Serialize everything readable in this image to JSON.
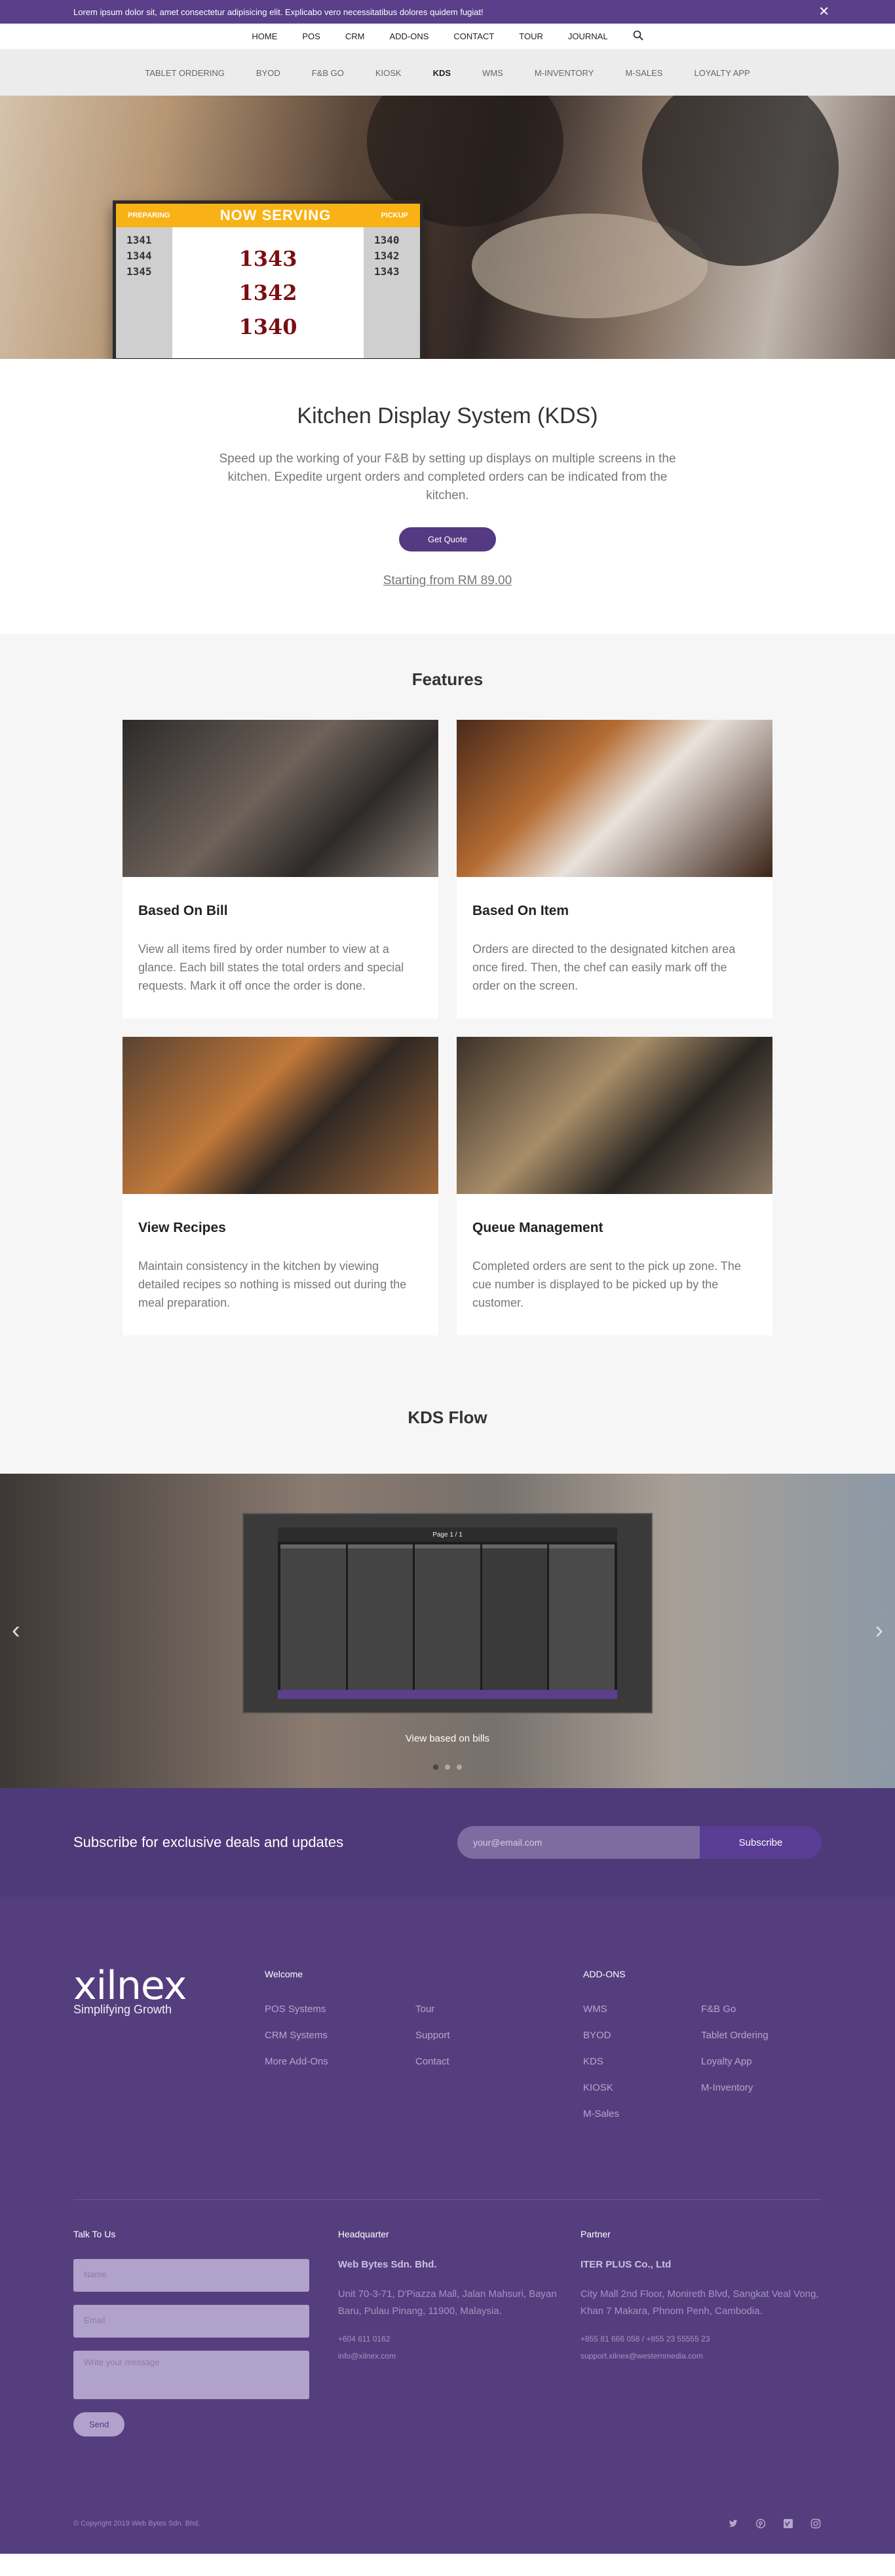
{
  "announcement": {
    "text": "Lorem ipsum dolor sit, amet consectetur adipisicing elit. Explicabo vero necessitatibus dolores quidem fugiat!",
    "close_icon": "✕"
  },
  "topnav": [
    "HOME",
    "POS",
    "CRM",
    "ADD-ONS",
    "CONTACT",
    "TOUR",
    "JOURNAL"
  ],
  "subnav": {
    "items": [
      "TABLET ORDERING",
      "BYOD",
      "F&B GO",
      "KIOSK",
      "KDS",
      "WMS",
      "M-INVENTORY",
      "M-SALES",
      "LOYALTY APP"
    ],
    "active": "KDS"
  },
  "hero_sign": {
    "title": "NOW SERVING",
    "left_label": "PREPARING",
    "right_label": "PICKUP",
    "preparing": [
      "1341",
      "1344",
      "1345"
    ],
    "serving": [
      "1343",
      "1342",
      "1340"
    ],
    "pickup": [
      "1340",
      "1342",
      "1343"
    ]
  },
  "intro": {
    "title": "Kitchen Display System (KDS)",
    "description": "Speed up the working of your F&B by setting up displays on multiple screens in the kitchen. Expedite urgent orders and completed orders can be indicated from the kitchen.",
    "cta": "Get Quote",
    "price": "Starting from RM 89.00"
  },
  "features": {
    "title": "Features",
    "cards": [
      {
        "title": "Based On Bill",
        "text": "View all items fired by order number to view at a glance. Each bill states the total orders and special requests. Mark it off once the order is done."
      },
      {
        "title": "Based On Item",
        "text": "Orders are directed to the designated kitchen area once fired. Then, the chef can easily mark off the order on the screen."
      },
      {
        "title": "View Recipes",
        "text": "Maintain consistency in the kitchen by viewing detailed recipes so nothing is missed out during the meal preparation."
      },
      {
        "title": "Queue Management",
        "text": "Completed orders are sent to the pick up zone. The cue number is displayed to be picked up by the customer."
      }
    ]
  },
  "flow": {
    "title": "KDS Flow",
    "caption": "View based on bills",
    "screen_page": "Page 1 / 1"
  },
  "subscribe": {
    "title": "Subscribe for exclusive deals and updates",
    "placeholder": "your@email.com",
    "button": "Subscribe"
  },
  "footer": {
    "logo": "xilnex",
    "tagline": "Simplifying Growth",
    "welcome": {
      "title": "Welcome",
      "col1": [
        "POS Systems",
        "CRM Systems",
        "More Add-Ons"
      ],
      "col2": [
        "Tour",
        "Support",
        "Contact"
      ]
    },
    "addons": {
      "title": "ADD-ONS",
      "col1": [
        "WMS",
        "BYOD",
        "KDS",
        "KIOSK",
        "M-Sales"
      ],
      "col2": [
        "F&B Go",
        "Tablet Ordering",
        "Loyalty App",
        "M-Inventory"
      ]
    },
    "talk": {
      "title": "Talk To Us",
      "name": "Name",
      "email": "Email",
      "message": "Write your message",
      "send": "Send"
    },
    "hq": {
      "title": "Headquarter",
      "company": "Web Bytes Sdn. Bhd.",
      "address": "Unit 70-3-71, D'Piazza Mall, Jalan Mahsuri, Bayan Baru, Pulau Pinang, 11900, Malaysia.",
      "phone": "+604 611 0162",
      "email": "info@xilnex.com"
    },
    "partner": {
      "title": "Partner",
      "company": "ITER PLUS Co., Ltd",
      "address": "City Mall 2nd Floor, Monireth Blvd, Sangkat Veal Vong, Khan 7 Makara, Phnom Penh, Cambodia.",
      "phone": "+855 81 666 058   /   +855 23 55555 23",
      "email": "support.xilnex@westernmedia.com"
    },
    "copyright": "© Copyright 2019 Web Bytes Sdn. Bhd."
  }
}
